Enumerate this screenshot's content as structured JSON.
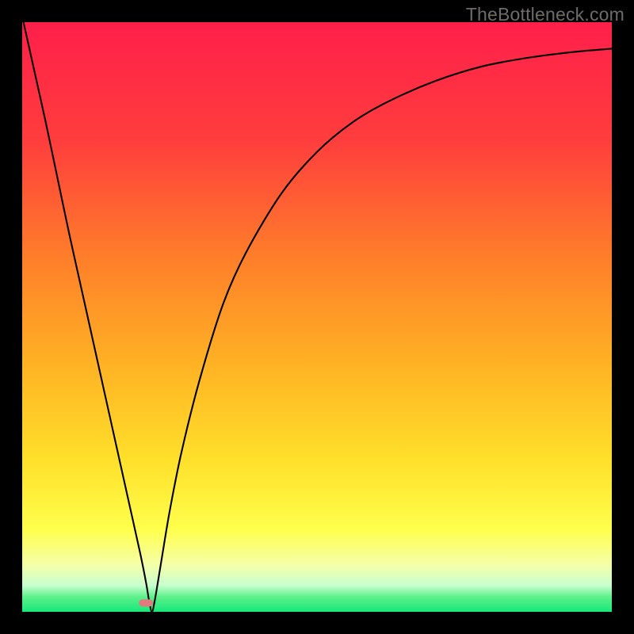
{
  "watermark": "TheBottleneck.com",
  "chart_data": {
    "type": "line",
    "title": "",
    "xlabel": "",
    "ylabel": "",
    "xlim": [
      0,
      100
    ],
    "ylim": [
      0,
      100
    ],
    "gradient_stops": [
      {
        "offset": 0.0,
        "color": "#ff1f4a"
      },
      {
        "offset": 0.2,
        "color": "#ff3d3d"
      },
      {
        "offset": 0.4,
        "color": "#ff7e2a"
      },
      {
        "offset": 0.58,
        "color": "#ffb224"
      },
      {
        "offset": 0.74,
        "color": "#ffdf2a"
      },
      {
        "offset": 0.86,
        "color": "#ffff4c"
      },
      {
        "offset": 0.92,
        "color": "#f5ffa8"
      },
      {
        "offset": 0.955,
        "color": "#c8ffcf"
      },
      {
        "offset": 0.975,
        "color": "#5cf08a"
      },
      {
        "offset": 1.0,
        "color": "#17e87a"
      }
    ],
    "series": [
      {
        "name": "bottleneck-curve",
        "x": [
          0.0,
          2.0,
          4.0,
          6.0,
          8.0,
          10.0,
          12.0,
          14.0,
          16.0,
          18.0,
          20.0,
          21.0,
          21.5,
          22.0,
          22.5,
          23.5,
          25.0,
          27.0,
          30.0,
          34.0,
          38.0,
          44.0,
          50.0,
          56.0,
          62.0,
          70.0,
          78.0,
          86.0,
          94.0,
          100.0
        ],
        "y": [
          101.0,
          92.0,
          83.0,
          73.5,
          64.0,
          55.0,
          46.0,
          37.0,
          28.0,
          19.0,
          10.0,
          5.0,
          2.0,
          0.0,
          2.0,
          8.0,
          17.0,
          27.0,
          39.0,
          52.0,
          61.0,
          71.0,
          78.0,
          83.0,
          86.5,
          90.0,
          92.5,
          94.0,
          95.0,
          95.5
        ]
      }
    ],
    "marker": {
      "x": 21.0,
      "y": 1.5,
      "color": "#e37a7f"
    }
  }
}
